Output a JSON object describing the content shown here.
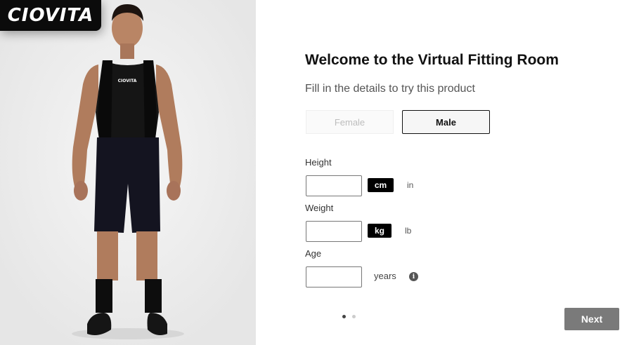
{
  "brand": {
    "logo_text": "CIOVITA"
  },
  "product_image": {
    "jersey_print": "CIOVITA"
  },
  "form": {
    "title": "Welcome to the Virtual Fitting Room",
    "subtitle": "Fill in the details to try this product",
    "gender": {
      "options": [
        {
          "label": "Female",
          "selected": false
        },
        {
          "label": "Male",
          "selected": true
        }
      ]
    },
    "height": {
      "label": "Height",
      "value": "",
      "units": [
        {
          "label": "cm",
          "active": true
        },
        {
          "label": "in",
          "active": false
        }
      ]
    },
    "weight": {
      "label": "Weight",
      "value": "",
      "units": [
        {
          "label": "kg",
          "active": true
        },
        {
          "label": "lb",
          "active": false
        }
      ]
    },
    "age": {
      "label": "Age",
      "value": "",
      "unit": "years",
      "info_icon": "info-icon"
    }
  },
  "pagination": {
    "total": 2,
    "current": 1
  },
  "next_button": {
    "label": "Next"
  },
  "colors": {
    "accent": "#000000",
    "next_bg": "#7a7a7a",
    "panel_bg": "#efefef"
  }
}
